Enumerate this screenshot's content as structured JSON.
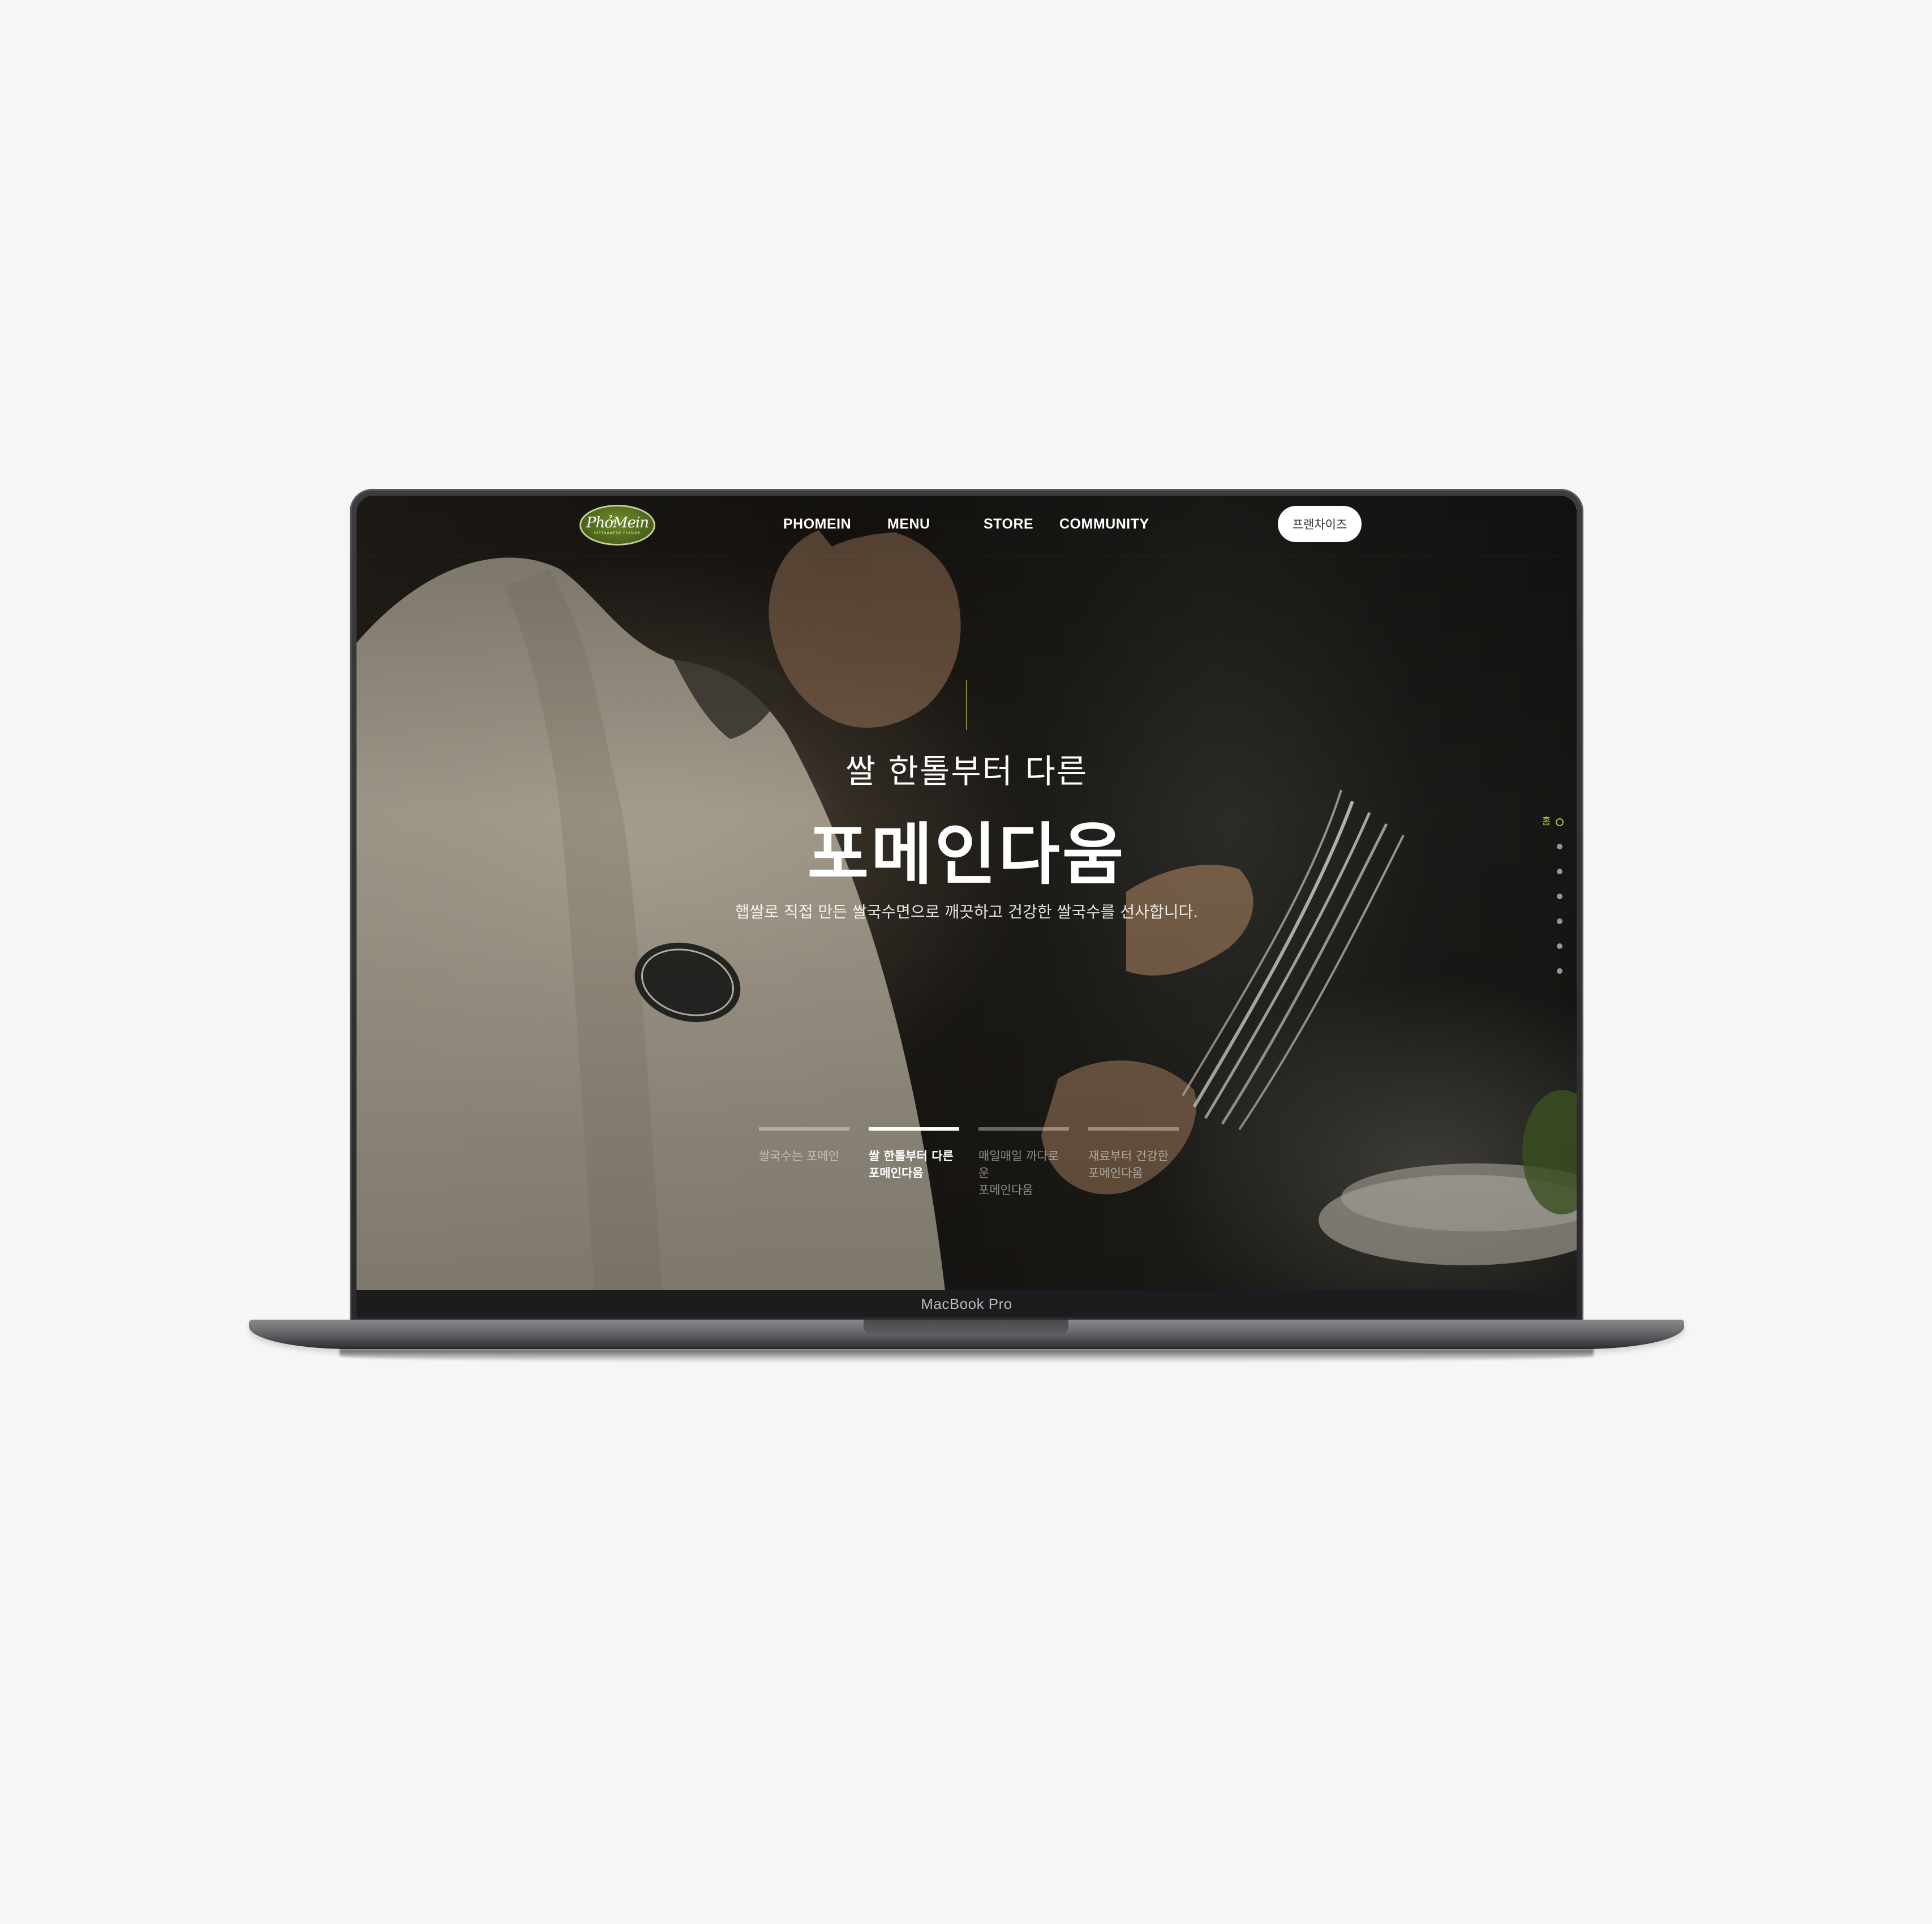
{
  "device": {
    "label": "MacBook Pro"
  },
  "header": {
    "logo_text": "PhởMein",
    "logo_sub": "VIETNAMESE CUISINE",
    "nav": [
      {
        "label": "PHOMEIN"
      },
      {
        "label": "MENU"
      },
      {
        "label": "STORE"
      },
      {
        "label": "COMMUNITY"
      }
    ],
    "franchise_button": "프랜차이즈"
  },
  "hero": {
    "subtitle": "쌀 한톨부터 다른",
    "title": "포메인다움",
    "description": "햅쌀로 직접 만든 쌀국수면으로 깨끗하고 건강한 쌀국수를 선사합니다."
  },
  "side_pager": {
    "label": "홈",
    "dot_count": 6
  },
  "tabs": [
    {
      "line1": "쌀국수는 포메인",
      "line2": "",
      "active": false
    },
    {
      "line1": "쌀 한톨부터 다른",
      "line2": "포메인다움",
      "active": true
    },
    {
      "line1": "매일매일 까다로운",
      "line2": "포메인다움",
      "active": false
    },
    {
      "line1": "재료부터 건강한",
      "line2": "포메인다움",
      "active": false
    }
  ],
  "colors": {
    "accent": "#a9c24a",
    "logo_green": "#4b6318",
    "background": "#f6f6f6"
  }
}
